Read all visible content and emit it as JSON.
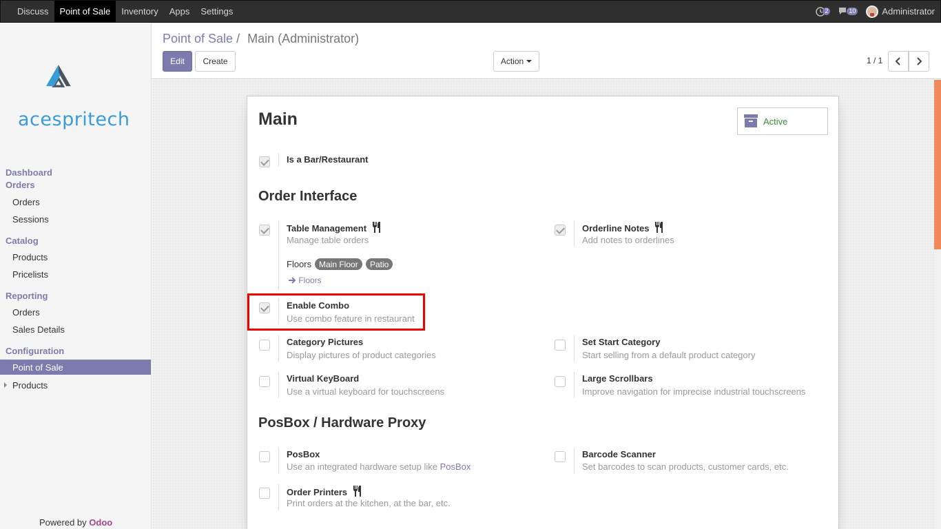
{
  "topbar": {
    "menu": [
      "Discuss",
      "Point of Sale",
      "Inventory",
      "Apps",
      "Settings"
    ],
    "activity_count": "2",
    "messages_count": "10",
    "user": "Administrator"
  },
  "sidebar": {
    "logo_text": "acespritech",
    "dashboard": "Dashboard",
    "orders_section": "Orders",
    "orders_items": [
      "Orders",
      "Sessions"
    ],
    "catalog_section": "Catalog",
    "catalog_items": [
      "Products",
      "Pricelists"
    ],
    "reporting_section": "Reporting",
    "reporting_items": [
      "Orders",
      "Sales Details"
    ],
    "configuration_section": "Configuration",
    "configuration_items": [
      "Point of Sale",
      "Products"
    ],
    "powered_by": "Powered by",
    "powered_brand": "Odoo"
  },
  "control_panel": {
    "breadcrumb_parent": "Point of Sale",
    "breadcrumb_sep": "/",
    "breadcrumb_current": "Main (Administrator)",
    "edit_label": "Edit",
    "create_label": "Create",
    "action_label": "Action",
    "pager": "1 / 1"
  },
  "form": {
    "title": "Main",
    "active_label": "Active",
    "is_bar_label": "Is a Bar/Restaurant",
    "order_interface_heading": "Order Interface",
    "table_management_title": "Table Management",
    "table_management_desc": "Manage table orders",
    "orderline_notes_title": "Orderline Notes",
    "orderline_notes_desc": "Add notes to orderlines",
    "floors_label": "Floors",
    "floor_tags": [
      "Main Floor",
      "Patio"
    ],
    "floors_link": "Floors",
    "enable_combo_title": "Enable Combo",
    "enable_combo_desc": "Use combo feature in restaurant",
    "category_pictures_title": "Category Pictures",
    "category_pictures_desc": "Display pictures of product categories",
    "set_start_category_title": "Set Start Category",
    "set_start_category_desc": "Start selling from a default product category",
    "virtual_keyboard_title": "Virtual KeyBoard",
    "virtual_keyboard_desc": "Use a virtual keyboard for touchscreens",
    "large_scrollbars_title": "Large Scrollbars",
    "large_scrollbars_desc": "Improve navigation for imprecise industrial touchscreens",
    "posbox_heading": "PosBox / Hardware Proxy",
    "posbox_title": "PosBox",
    "posbox_desc": "Use an integrated hardware setup like",
    "posbox_desc_link": "PosBox",
    "barcode_scanner_title": "Barcode Scanner",
    "barcode_scanner_desc": "Set barcodes to scan products, customer cards, etc.",
    "order_printers_title": "Order Printers",
    "order_printers_desc": "Print orders at the kitchen, at the bar, etc."
  },
  "colors": {
    "brand": "#7c7bad",
    "highlight": "#ee0000",
    "logo_blue": "#3a9cd6"
  }
}
